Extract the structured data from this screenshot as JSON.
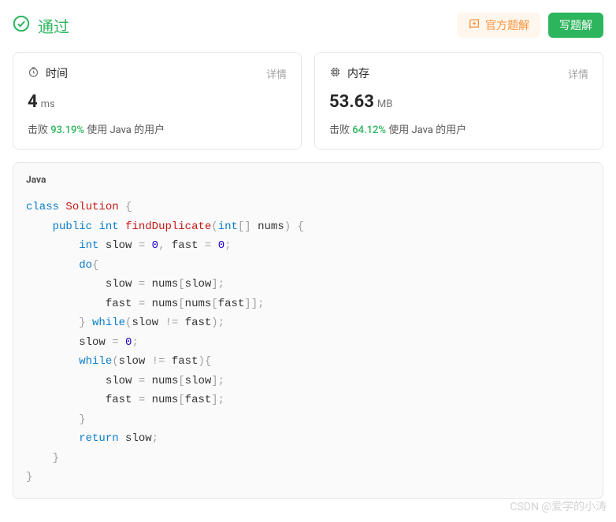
{
  "status": {
    "text": "通过"
  },
  "actions": {
    "official": "官方题解",
    "write": "写题解"
  },
  "time": {
    "icon_label": "时间",
    "detail": "详情",
    "value": "4",
    "unit": "ms",
    "beat_label": "击败",
    "percent": "93.19%",
    "desc_rest": " 使用 Java 的用户"
  },
  "memory": {
    "icon_label": "内存",
    "detail": "详情",
    "value": "53.63",
    "unit": "MB",
    "beat_label": "击败",
    "percent": "64.12%",
    "desc_rest": " 使用 Java 的用户"
  },
  "code": {
    "lang": "Java",
    "tokens": {
      "class": "class",
      "Solution": "Solution",
      "public": "public",
      "int": "int",
      "findDuplicate": "findDuplicate",
      "nums": "nums",
      "slow": "slow",
      "fast": "fast",
      "zero": "0",
      "do": "do",
      "while": "while",
      "return": "return"
    }
  },
  "watermark": "CSDN @爱学的小涛"
}
